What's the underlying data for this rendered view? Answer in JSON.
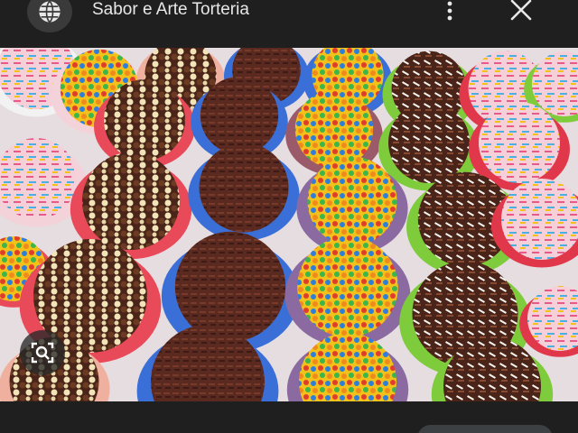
{
  "header": {
    "site_title": "Sabor e Arte Torteria",
    "globe_icon": "globe-icon",
    "more_icon": "more-vert-icon",
    "close_icon": "close-icon"
  },
  "image": {
    "description_icon": "brigadeiro-photo",
    "lens_icon": "lens-search-icon"
  },
  "footer": {
    "caption": "",
    "visit_button_label": ""
  },
  "colors": {
    "background": "#1f1f1f",
    "text": "#e8e8e8",
    "button": "#3c4043"
  }
}
